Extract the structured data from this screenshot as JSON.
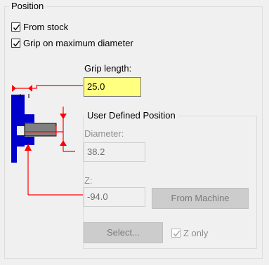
{
  "group": {
    "title": "Position"
  },
  "checkboxes": [
    {
      "label": "From stock",
      "checked": true
    },
    {
      "label": "Grip on maximum diameter",
      "checked": true
    }
  ],
  "grip": {
    "label": "Grip length:",
    "value": "25.0"
  },
  "user_defined": {
    "title": "User Defined Position",
    "diameter_label": "Diameter:",
    "diameter_value": "38.2",
    "z_label": "Z:",
    "z_value": "-94.0",
    "from_machine_label": "From Machine",
    "select_label": "Select...",
    "z_only_label": "Z only",
    "z_only_checked": true
  },
  "colors": {
    "yellow_field": "#ffff80",
    "diagram_red": "#ff0000",
    "diagram_blue": "#0000cc"
  },
  "icons": [
    "checkmark-icon",
    "grip-diagram-icon"
  ]
}
